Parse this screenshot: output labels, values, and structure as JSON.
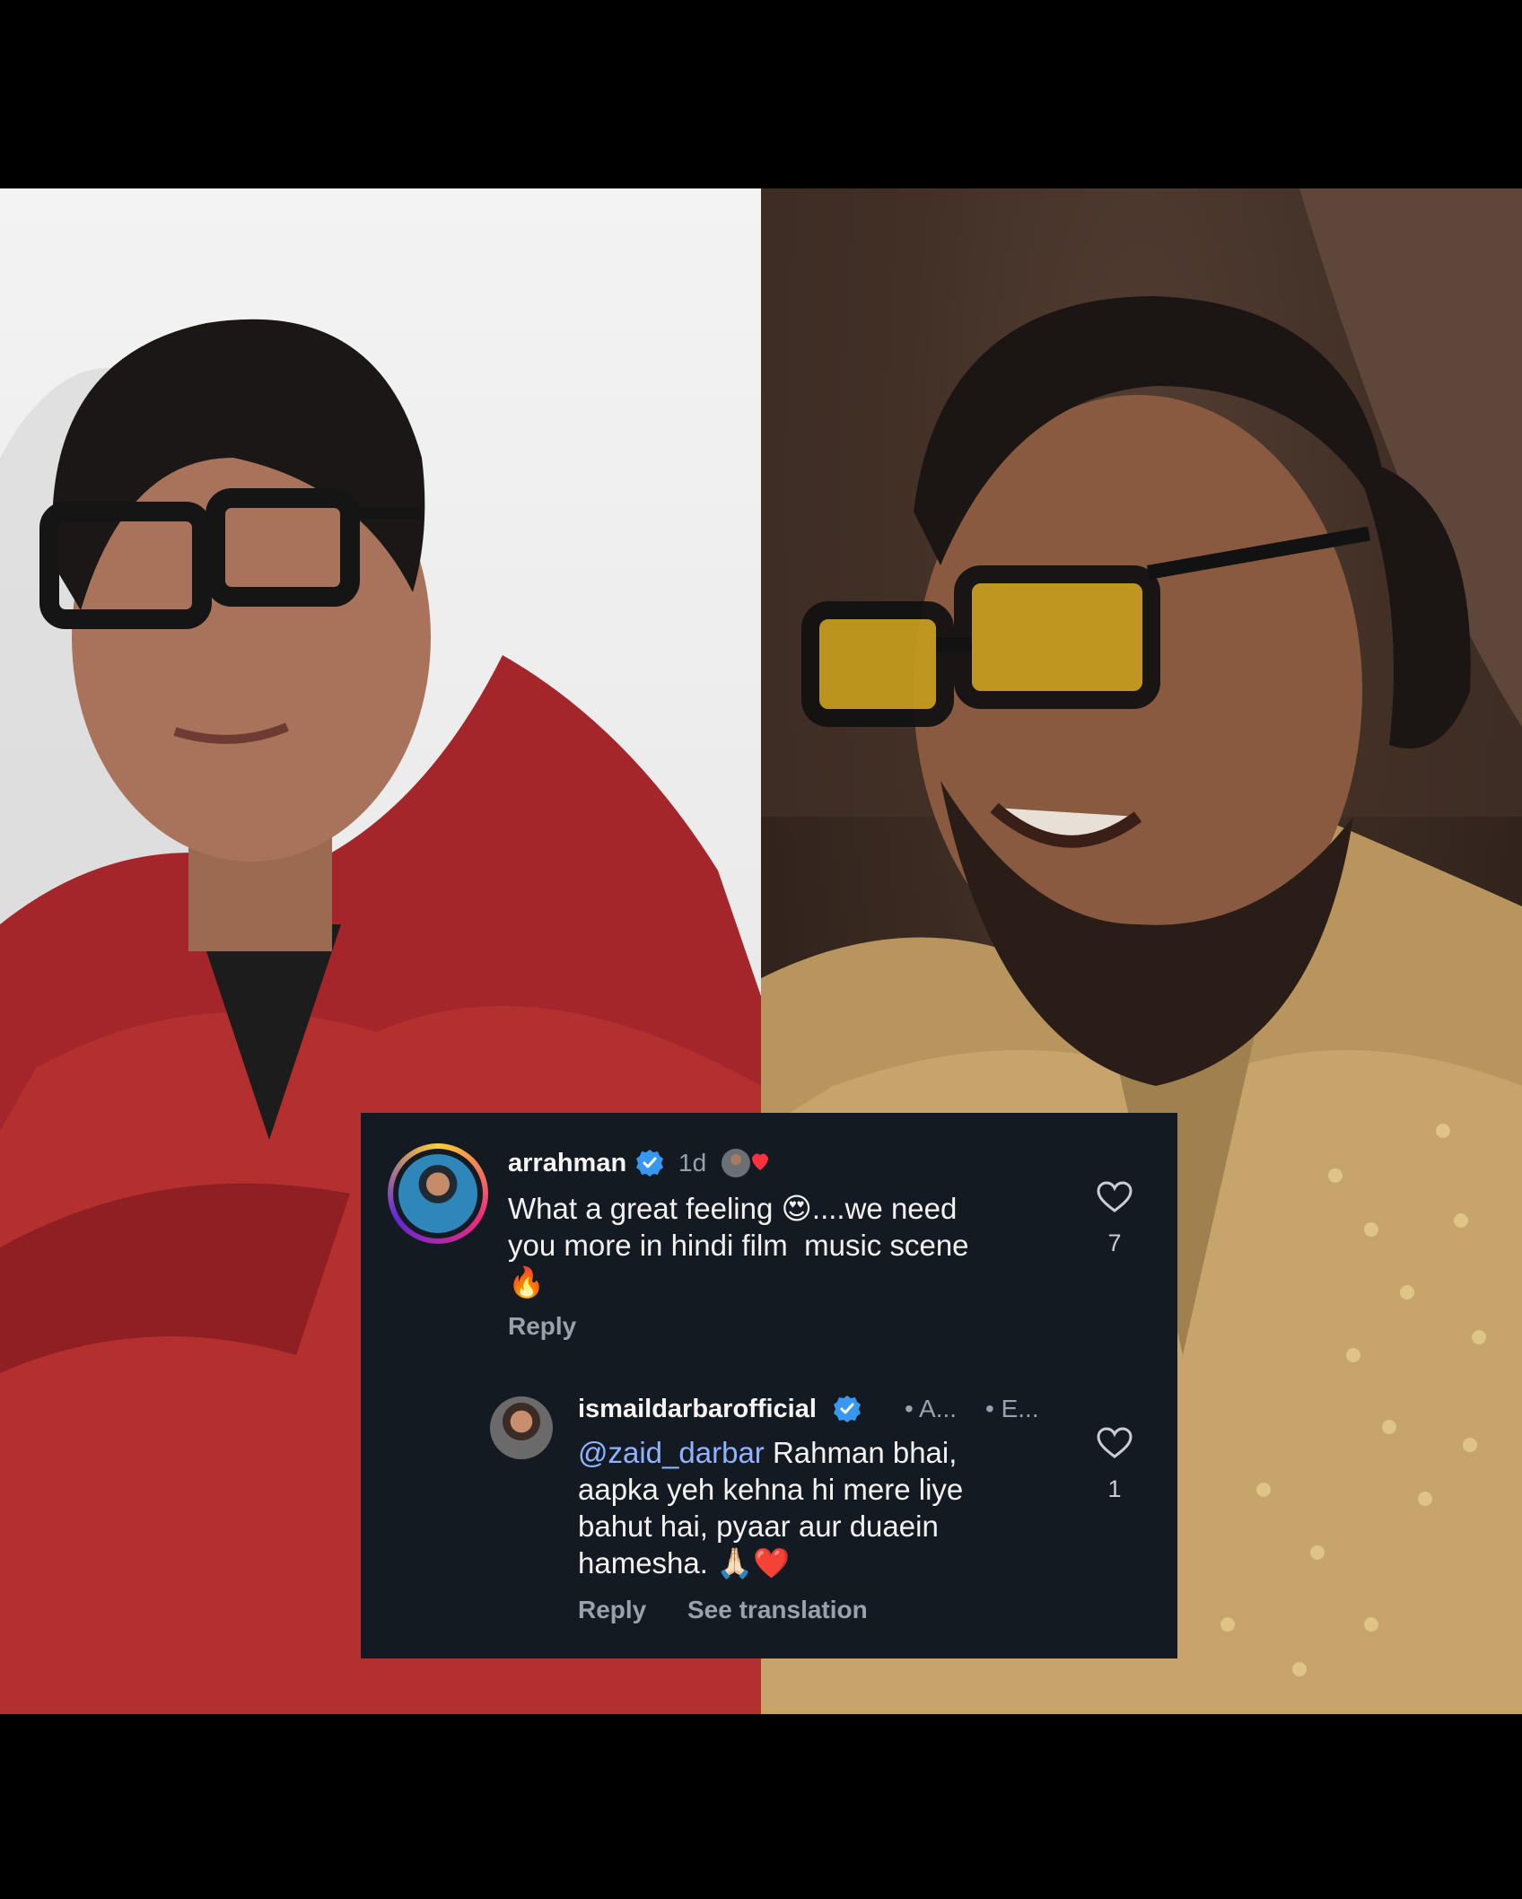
{
  "comments": [
    {
      "username": "arrahman",
      "time": "1d",
      "text_main": "What a great feeling ",
      "text_emoji": "😍",
      "text_rest": "....we need\nyou more in hindi film  music scene\n",
      "text_end_emoji": "🔥",
      "reply_label": "Reply",
      "like_count": "7"
    },
    {
      "username": "ismaildarbarofficial",
      "meta_a": "• A...",
      "meta_e": "• E...",
      "mention": "@zaid_darbar",
      "text_main": " Rahman bhai,\naapka yeh kehna hi mere liye\nbahut hai, pyaar aur duaein\nhamesha. ",
      "text_emoji": "🙏🏻❤️",
      "reply_label": "Reply",
      "translation_label": "See translation",
      "like_count": "1"
    }
  ],
  "icons": {
    "verified": "verified-badge-icon",
    "like": "heart-outline-icon",
    "liked_by_author": "author-liked-icon"
  },
  "colors": {
    "card_bg": "#141a22",
    "verified_blue": "#3897f0",
    "mention": "#8fb3ff",
    "muted": "#9aa1aa"
  }
}
